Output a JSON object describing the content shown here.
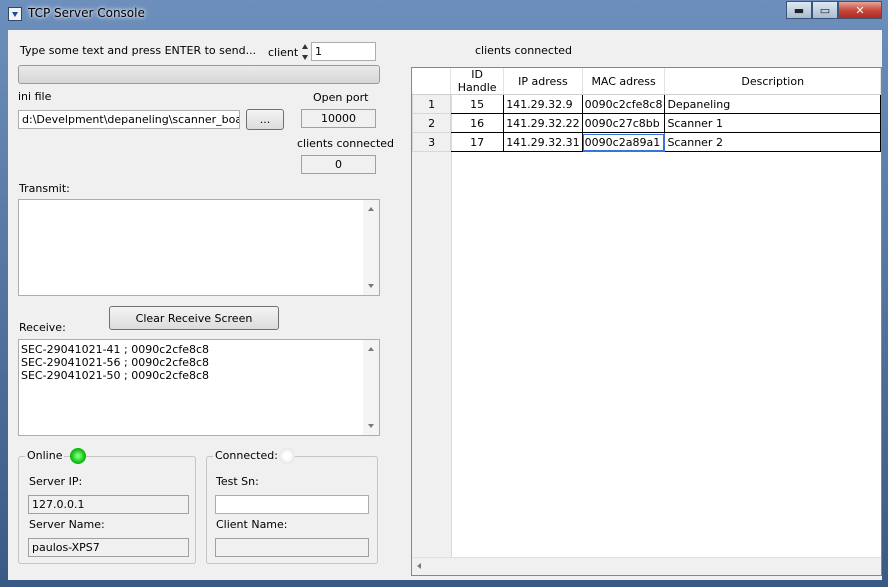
{
  "window": {
    "title": "TCP Server Console",
    "minimize": "▬",
    "maximize": "▭",
    "close": "✕"
  },
  "send": {
    "label": "Type some text and press ENTER to send...",
    "client_label": "client",
    "client_value": "1"
  },
  "ini": {
    "label": "ini file",
    "path": "d:\\Develpment\\depaneling\\scanner_board_c",
    "browse_label": "..."
  },
  "port": {
    "label": "Open port",
    "value": "10000"
  },
  "connected_count": {
    "label": "clients connected",
    "value": "0"
  },
  "transmit": {
    "label": "Transmit:"
  },
  "clear_button": "Clear Receive Screen",
  "receive": {
    "label": "Receive:",
    "lines": [
      "SEC-29041021-41 ; 0090c2cfe8c8",
      "SEC-29041021-56 ; 0090c2cfe8c8",
      "SEC-29041021-50 ; 0090c2cfe8c8"
    ]
  },
  "online_group": {
    "title": "Online",
    "status_color": "#16c516",
    "server_ip_label": "Server IP:",
    "server_ip": "127.0.0.1",
    "server_name_label": "Server Name:",
    "server_name": "paulos-XPS7"
  },
  "connected_group": {
    "title": "Connected:",
    "status_color": "#e6e6e6",
    "test_sn_label": "Test Sn:",
    "test_sn": "",
    "client_name_label": "Client Name:",
    "client_name": ""
  },
  "clients_grid": {
    "title": "clients connected",
    "columns": [
      "ID Handle",
      "IP adress",
      "MAC adress",
      "Description"
    ],
    "rows": [
      {
        "num": "1",
        "id": "15",
        "ip": "141.29.32.9",
        "mac": "0090c2cfe8c8",
        "desc": "Depaneling"
      },
      {
        "num": "2",
        "id": "16",
        "ip": "141.29.32.22",
        "mac": "0090c27c8bb",
        "desc": "Scanner 1"
      },
      {
        "num": "3",
        "id": "17",
        "ip": "141.29.32.31",
        "mac": "0090c2a89a1",
        "desc": "Scanner 2"
      }
    ]
  }
}
